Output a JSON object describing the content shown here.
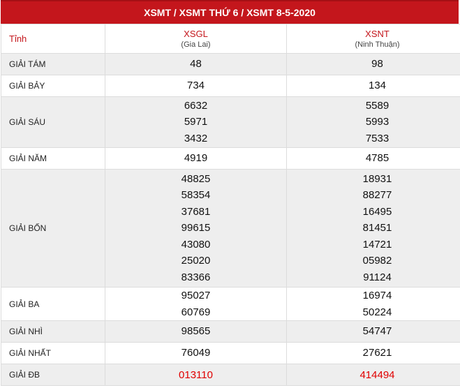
{
  "title": "XSMT / XSMT THỨ 6 / XSMT 8-5-2020",
  "header": {
    "tinh_label": "Tỉnh",
    "provinces": [
      {
        "code": "XSGL",
        "name": "(Gia Lai)"
      },
      {
        "code": "XSNT",
        "name": "(Ninh Thuận)"
      }
    ]
  },
  "prizes": [
    {
      "label": "GIẢI TÁM",
      "col1": [
        "48"
      ],
      "col2": [
        "98"
      ]
    },
    {
      "label": "GIẢI BẢY",
      "col1": [
        "734"
      ],
      "col2": [
        "134"
      ]
    },
    {
      "label": "GIẢI SÁU",
      "col1": [
        "6632",
        "5971",
        "3432"
      ],
      "col2": [
        "5589",
        "5993",
        "7533"
      ]
    },
    {
      "label": "GIẢI NĂM",
      "col1": [
        "4919"
      ],
      "col2": [
        "4785"
      ]
    },
    {
      "label": "GIẢI BỐN",
      "col1": [
        "48825",
        "58354",
        "37681",
        "99615",
        "43080",
        "25020",
        "83366"
      ],
      "col2": [
        "18931",
        "88277",
        "16495",
        "81451",
        "14721",
        "05982",
        "91124"
      ]
    },
    {
      "label": "GIẢI BA",
      "col1": [
        "95027",
        "60769"
      ],
      "col2": [
        "16974",
        "50224"
      ]
    },
    {
      "label": "GIẢI NHÌ",
      "col1": [
        "98565"
      ],
      "col2": [
        "54747"
      ]
    },
    {
      "label": "GIẢI NHẤT",
      "col1": [
        "76049"
      ],
      "col2": [
        "27621"
      ]
    },
    {
      "label": "GIẢI ĐB",
      "col1": [
        "013110"
      ],
      "col2": [
        "414494"
      ]
    }
  ],
  "colors": {
    "accent": "#c4161c",
    "special": "#e00000",
    "alt_row": "#eeeeee"
  }
}
